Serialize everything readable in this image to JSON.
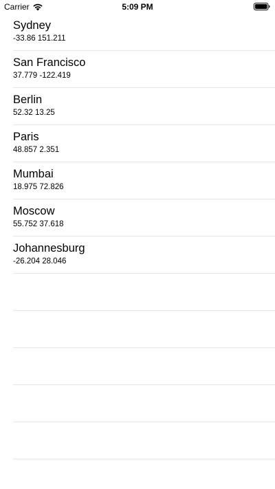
{
  "status_bar": {
    "carrier": "Carrier",
    "time": "5:09 PM"
  },
  "cities": [
    {
      "name": "Sydney",
      "coords": "-33.86 151.211"
    },
    {
      "name": "San Francisco",
      "coords": "37.779 -122.419"
    },
    {
      "name": "Berlin",
      "coords": "52.32 13.25"
    },
    {
      "name": "Paris",
      "coords": "48.857 2.351"
    },
    {
      "name": "Mumbai",
      "coords": "18.975 72.826"
    },
    {
      "name": "Moscow",
      "coords": "55.752 37.618"
    },
    {
      "name": "Johannesburg",
      "coords": "-26.204 28.046"
    }
  ]
}
